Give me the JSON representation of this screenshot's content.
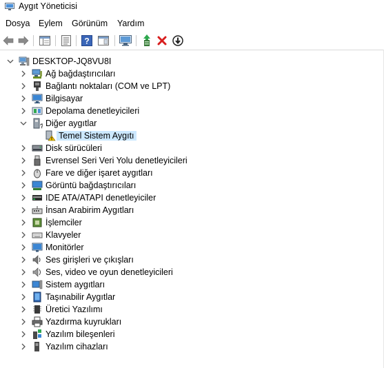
{
  "window": {
    "title": "Aygıt Yöneticisi"
  },
  "menu": [
    "Dosya",
    "Eylem",
    "Görünüm",
    "Yardım"
  ],
  "toolbar": [
    {
      "name": "back-icon"
    },
    {
      "name": "forward-icon"
    },
    {
      "name": "show-hide-console-tree-icon"
    },
    {
      "name": "properties-icon"
    },
    {
      "name": "help-icon"
    },
    {
      "name": "action-pane-icon"
    },
    {
      "name": "scan-hardware-icon"
    },
    {
      "name": "update-driver-icon"
    },
    {
      "name": "uninstall-icon"
    },
    {
      "name": "disable-device-icon"
    }
  ],
  "tree": {
    "root": "DESKTOP-JQ8VU8I",
    "items": [
      {
        "label": "Ağ bağdaştırıcıları",
        "icon": "network-adapter-icon"
      },
      {
        "label": "Bağlantı noktaları (COM ve LPT)",
        "icon": "port-icon"
      },
      {
        "label": "Bilgisayar",
        "icon": "computer-icon"
      },
      {
        "label": "Depolama denetleyicileri",
        "icon": "storage-controller-icon"
      },
      {
        "label": "Diğer aygıtlar",
        "icon": "other-devices-icon",
        "expanded": true
      },
      {
        "label": "Temel Sistem Aygıtı",
        "icon": "unknown-device-warning-icon",
        "child": true,
        "selected": true
      },
      {
        "label": "Disk sürücüleri",
        "icon": "disk-drive-icon"
      },
      {
        "label": "Evrensel Seri Veri Yolu denetleyicileri",
        "icon": "usb-icon"
      },
      {
        "label": "Fare ve diğer işaret aygıtları",
        "icon": "mouse-icon"
      },
      {
        "label": "Görüntü bağdaştırıcıları",
        "icon": "display-adapter-icon"
      },
      {
        "label": "IDE ATA/ATAPI denetleyiciler",
        "icon": "ide-controller-icon"
      },
      {
        "label": "İnsan Arabirim Aygıtları",
        "icon": "hid-icon"
      },
      {
        "label": "İşlemciler",
        "icon": "processor-icon"
      },
      {
        "label": "Klavyeler",
        "icon": "keyboard-icon"
      },
      {
        "label": "Monitörler",
        "icon": "monitor-icon"
      },
      {
        "label": "Ses girişleri ve çıkışları",
        "icon": "speaker-icon"
      },
      {
        "label": "Ses, video ve oyun denetleyicileri",
        "icon": "sound-icon"
      },
      {
        "label": "Sistem aygıtları",
        "icon": "system-devices-icon"
      },
      {
        "label": "Taşınabilir Aygıtlar",
        "icon": "portable-device-icon"
      },
      {
        "label": "Üretici Yazılımı",
        "icon": "firmware-icon"
      },
      {
        "label": "Yazdırma kuyrukları",
        "icon": "printer-icon"
      },
      {
        "label": "Yazılım bileşenleri",
        "icon": "software-component-icon"
      },
      {
        "label": "Yazılım cihazları",
        "icon": "software-device-icon"
      }
    ]
  }
}
